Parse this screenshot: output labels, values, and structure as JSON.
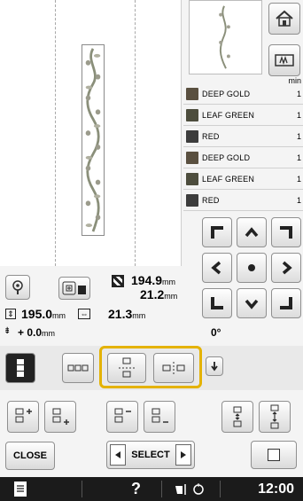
{
  "color_list": {
    "min_label": "min",
    "threads": [
      {
        "name": "DEEP GOLD",
        "count": "1",
        "color": "#6b5b2e"
      },
      {
        "name": "LEAF GREEN",
        "count": "1",
        "color": "#4d4d3d"
      },
      {
        "name": "RED",
        "count": "1",
        "color": "#3d3d3d"
      },
      {
        "name": "DEEP GOLD",
        "count": "1",
        "color": "#6b5b2e"
      },
      {
        "name": "LEAF GREEN",
        "count": "1",
        "color": "#4d4d3d"
      },
      {
        "name": "RED",
        "count": "1",
        "color": "#3d3d3d"
      }
    ]
  },
  "size_info": {
    "height_value": "194.9",
    "height_unit": "mm",
    "width_value": "21.2",
    "width_unit": "mm"
  },
  "dimensions": {
    "total_height": "195.0",
    "total_height_unit": "mm",
    "total_width": "21.3",
    "total_width_unit": "mm",
    "spacing_prefix": "+",
    "spacing_value": "0.0",
    "spacing_unit": "mm",
    "angle_value": "0°"
  },
  "buttons": {
    "close_label": "CLOSE",
    "select_label": "SELECT"
  },
  "status_bar": {
    "help": "?",
    "time": "12:00"
  },
  "colors": {
    "highlight": "#e4b200",
    "status_bg": "#1b1b1b"
  }
}
